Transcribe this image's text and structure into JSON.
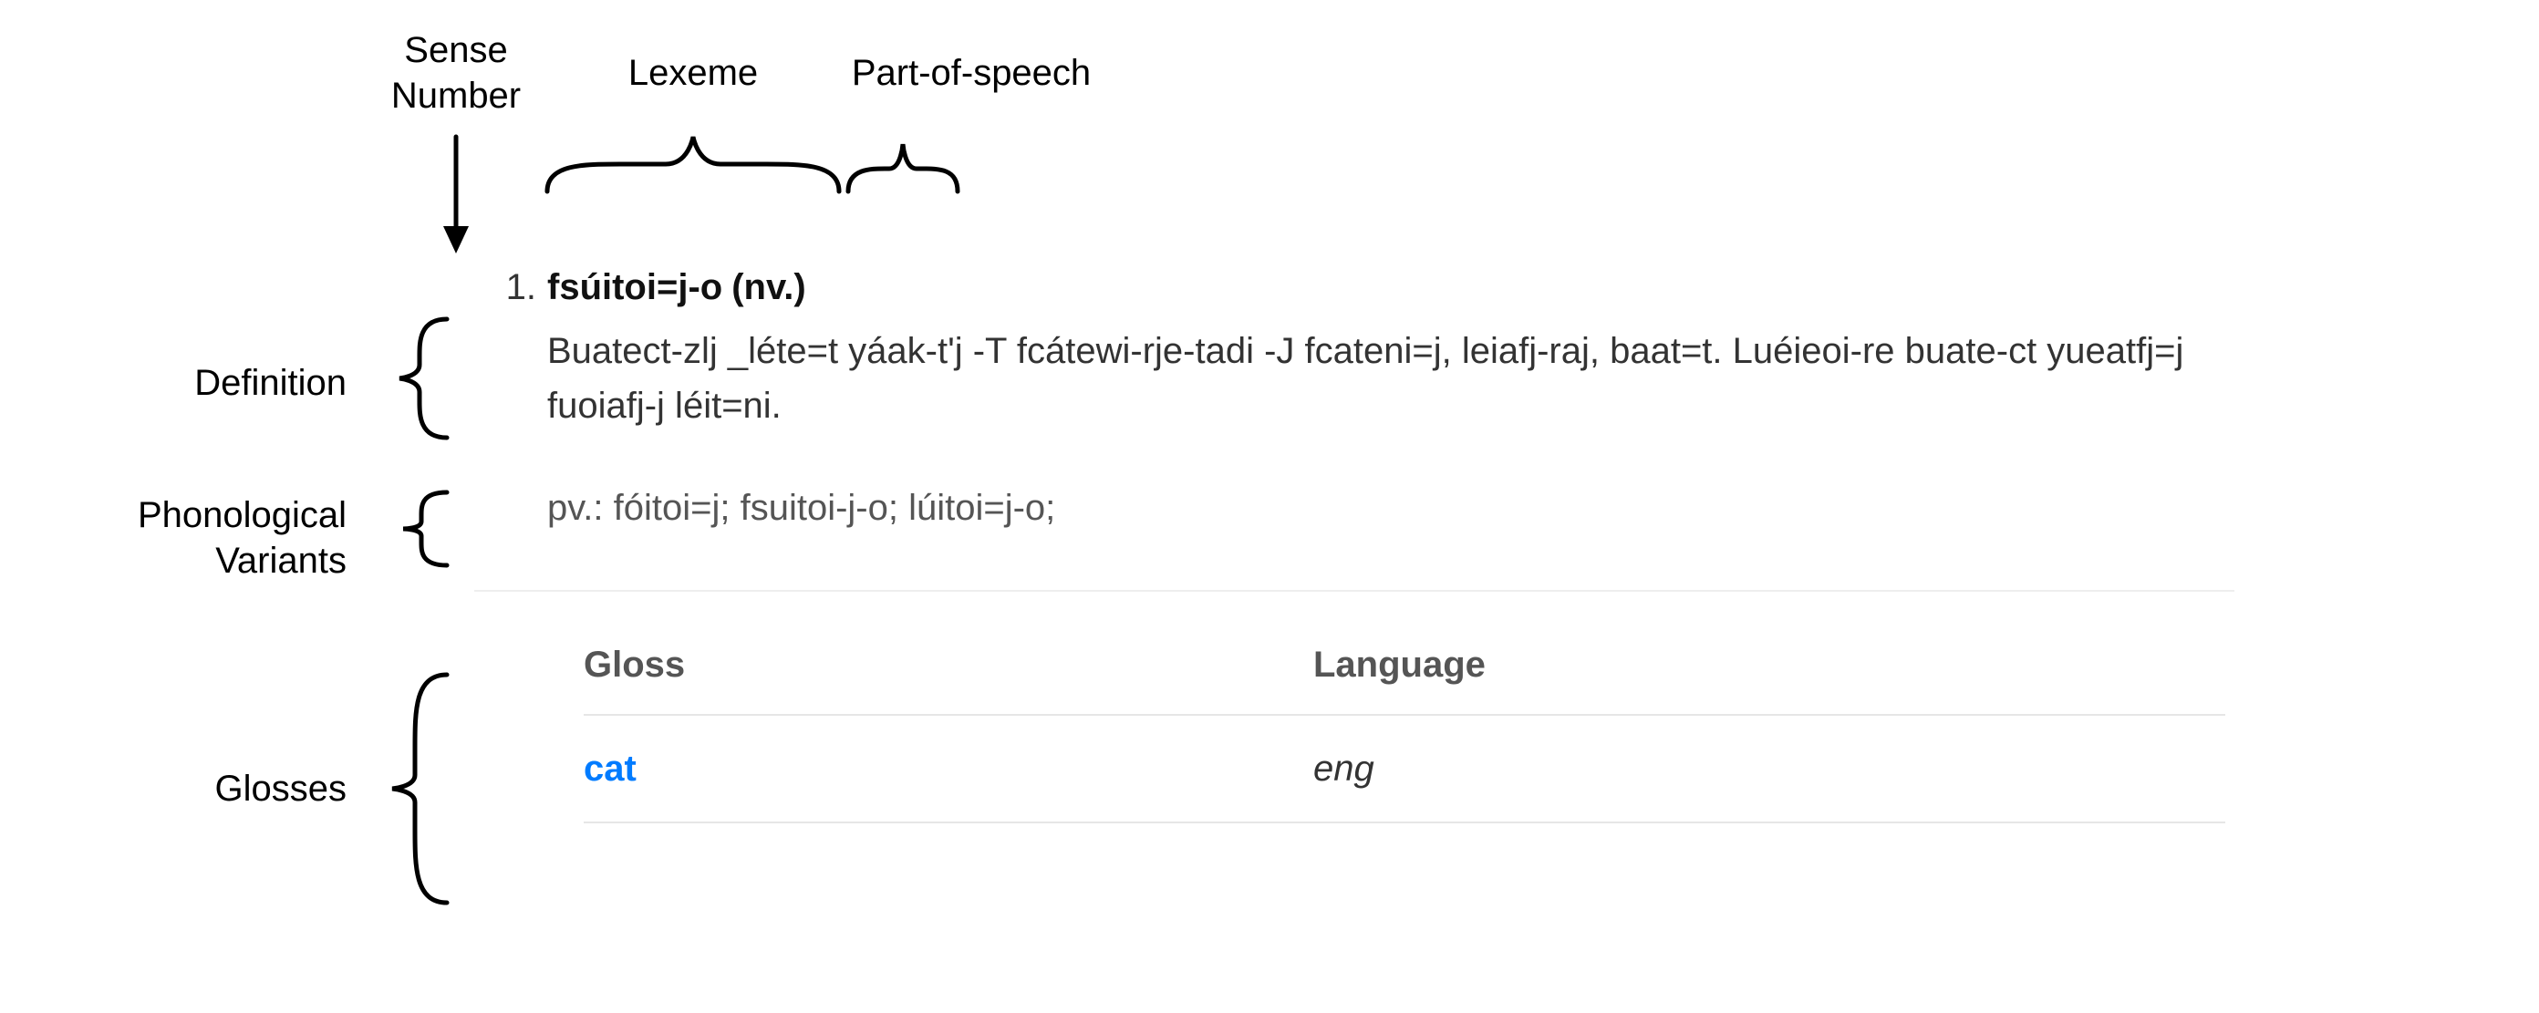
{
  "annotations": {
    "sense_number": "Sense\nNumber",
    "lexeme": "Lexeme",
    "pos": "Part-of-speech",
    "definition": "Definition",
    "phonological_variants": "Phonological\nVariants",
    "glosses": "Glosses"
  },
  "entry": {
    "sense_number": "1.",
    "lexeme": "fsúitoi=j-o",
    "pos": "(nv.)",
    "definition": "Buatect-zlj _léte=t yáak-t'j -T fcátewi-rje-tadi -J fcateni=j, leiafj-raj, baat=t. Luéieoi-re buate-ct yueatfj=j fuoiafj-j léit=ni.",
    "phonological_variants": "pv.: fóitoi=j; fsuitoi-j-o; lúitoi=j-o;"
  },
  "gloss_table": {
    "headers": {
      "gloss": "Gloss",
      "language": "Language"
    },
    "rows": [
      {
        "gloss": "cat",
        "language": "eng"
      }
    ]
  }
}
